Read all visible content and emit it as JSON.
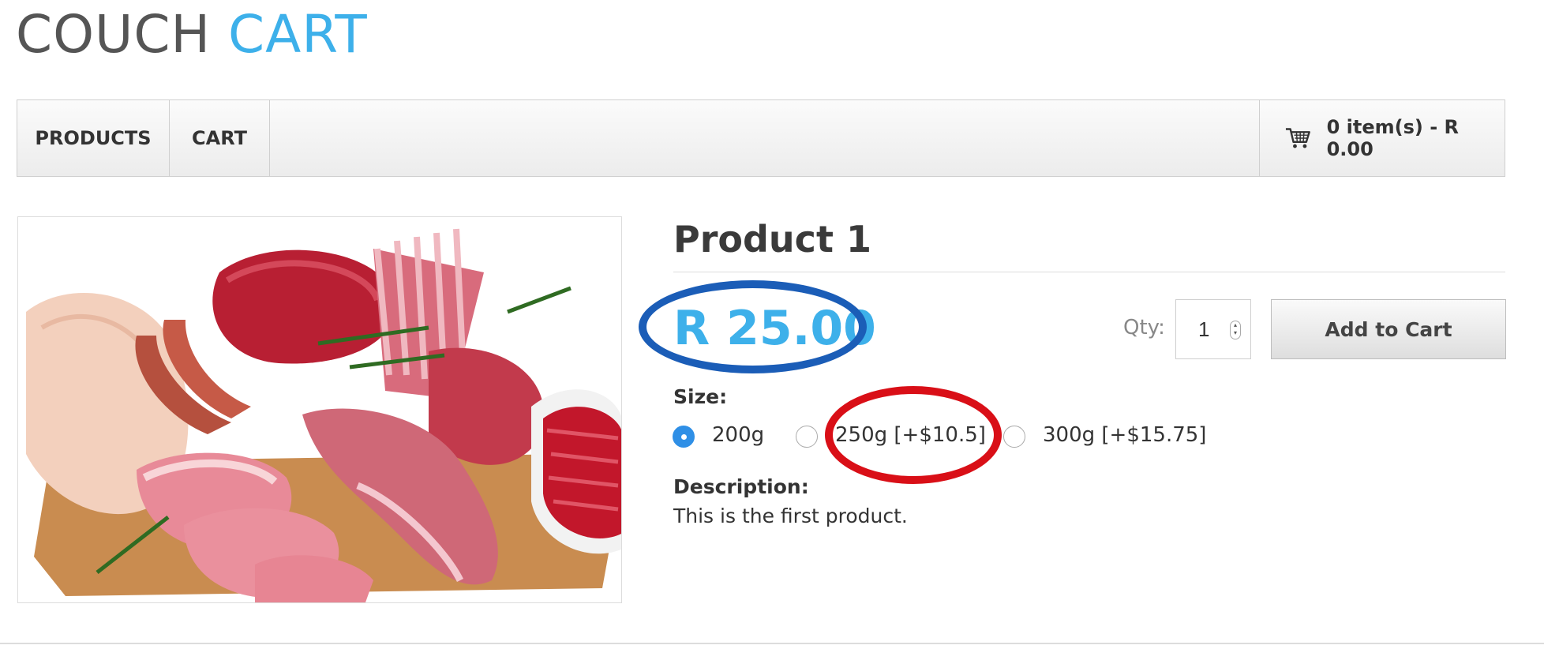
{
  "logo": {
    "word1": "COUCH",
    "word2": "CART"
  },
  "nav": {
    "items": [
      {
        "label": "PRODUCTS"
      },
      {
        "label": "CART"
      }
    ],
    "cart_summary": "0 item(s) - R 0.00",
    "cart_icon": "shopping-cart-icon"
  },
  "product": {
    "title": "Product 1",
    "price": "R 25.00",
    "image_alt": "meat-assortment-image",
    "qty_label": "Qty:",
    "qty_value": "1",
    "add_to_cart_label": "Add to Cart",
    "size_label": "Size:",
    "size_options": [
      {
        "label": "200g",
        "selected": true
      },
      {
        "label": "250g [+$10.5]",
        "selected": false
      },
      {
        "label": "300g [+$15.75]",
        "selected": false
      }
    ],
    "description_label": "Description:",
    "description": "This is the first product."
  },
  "annotations": {
    "price_highlight_color": "#1b5db7",
    "option_highlight_color": "#d90f17"
  },
  "colors": {
    "brand_blue": "#3db0ea",
    "logo_gray": "#555555",
    "radio_selected": "#2f8fe6"
  }
}
